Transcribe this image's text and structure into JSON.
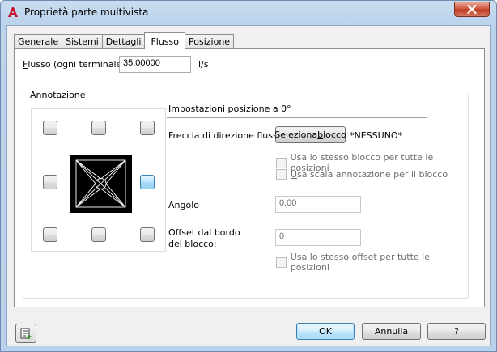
{
  "window": {
    "title": "Proprietà parte multivista",
    "close_icon": "close-icon",
    "app_icon": "autocad-icon"
  },
  "tabs": [
    {
      "label": "Generale"
    },
    {
      "label": "Sistemi"
    },
    {
      "label": "Dettagli"
    },
    {
      "label": "Flusso",
      "active": true
    },
    {
      "label": "Posizione"
    }
  ],
  "flow": {
    "label_prefix": "F",
    "label_rest": "lusso (ogni terminale):",
    "value": "35.00000",
    "unit": "l/s"
  },
  "annotation": {
    "group_title": "Annotazione",
    "section_title": "Impostazioni posizione a 0°",
    "arrow_label": "Freccia di direzione flusso:",
    "select_block_button_prefix": "Seleziona ",
    "select_block_button_u": "b",
    "select_block_button_rest": "locco",
    "block_name": "*NESSUNO*",
    "same_block_label": "Usa lo stesso blocco per tutte le posizioni",
    "annotation_scale_prefix": "",
    "annotation_scale_u": "U",
    "annotation_scale_rest": "sa scala annotazione per il blocco",
    "angle_label": "Angolo",
    "angle_value": "0.00",
    "offset_label_line1": "Offset dal bordo",
    "offset_label_line2": "del blocco:",
    "offset_value": "0",
    "same_offset_label": "Usa lo stesso offset per tutte le posizioni",
    "selected_position": "right"
  },
  "buttons": {
    "ok": "OK",
    "cancel": "Annulla",
    "help": "?"
  },
  "colors": {
    "titlebar": "#bcd3ec",
    "close": "#c13d24",
    "selected_button": "#bee6fd"
  }
}
